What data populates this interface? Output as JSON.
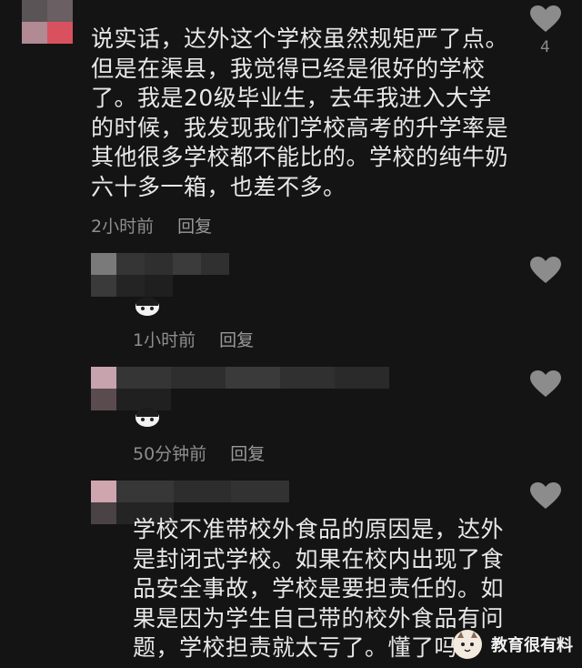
{
  "comments": [
    {
      "id": "c1",
      "text_lines": [
        "说实话，达外这个学校虽然规矩严了点。",
        "但是在渠县，我觉得已经是很好的学校",
        "了。我是20级毕业生，去年我进入大学",
        "的时候，我发现我们学校高考的升学率是",
        "其他很多学校都不能比的。学校的纯牛奶",
        "六十多一箱，也差不多。"
      ],
      "time": "2小时前",
      "reply_label": "回复",
      "likes": "4"
    },
    {
      "id": "c2",
      "time": "1小时前",
      "reply_label": "回复"
    },
    {
      "id": "c3",
      "time": "50分钟前",
      "reply_label": "回复"
    },
    {
      "id": "c4",
      "text_lines": [
        "学校不准带校外食品的原因是，达外",
        "是封闭式学校。如果在校内出现了食",
        "品安全事故，学校是要担责任的。如",
        "果是因为学生自己带的校外食品有问",
        "题，学校担责就太亏了。懂了吗"
      ]
    }
  ],
  "watermark": {
    "text": "教育很有料"
  },
  "colors": {
    "background": "#141414",
    "heart": "#8c8c8c",
    "text": "#e8e8e8",
    "meta": "#8e8e8e"
  },
  "icons": [
    "heart-icon",
    "panda-sticker-icon",
    "cat-face-icon"
  ]
}
